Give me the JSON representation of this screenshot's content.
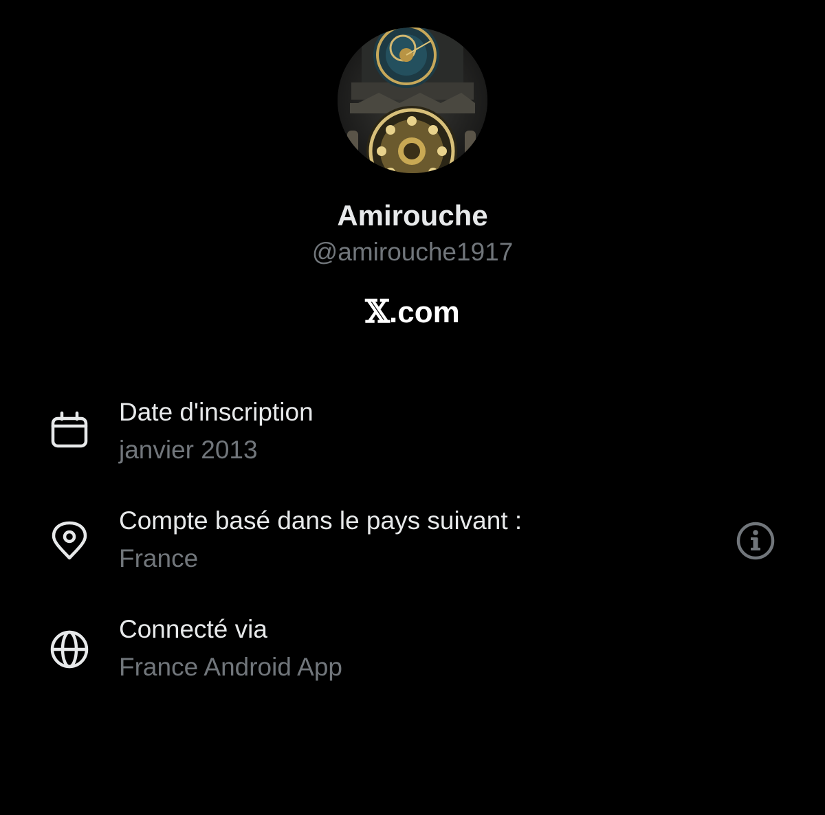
{
  "profile": {
    "avatar_alt": "astronomical-clock-avatar",
    "display_name": "Amirouche",
    "handle": "@amirouche1917"
  },
  "brand": {
    "x_letter": "𝕏",
    "suffix": ".com"
  },
  "details": [
    {
      "icon": "calendar-icon",
      "label": "Date d'inscription",
      "value": "janvier 2013"
    },
    {
      "icon": "location-pin-icon",
      "label": "Compte basé dans le pays suivant :",
      "value": "France"
    },
    {
      "icon": "globe-icon",
      "label": "Connecté via",
      "value": "France Android App"
    }
  ],
  "info_button": {
    "icon": "info-icon"
  },
  "colors": {
    "background": "#000000",
    "primary_text": "#e7e9ea",
    "secondary_text": "#71767b"
  }
}
